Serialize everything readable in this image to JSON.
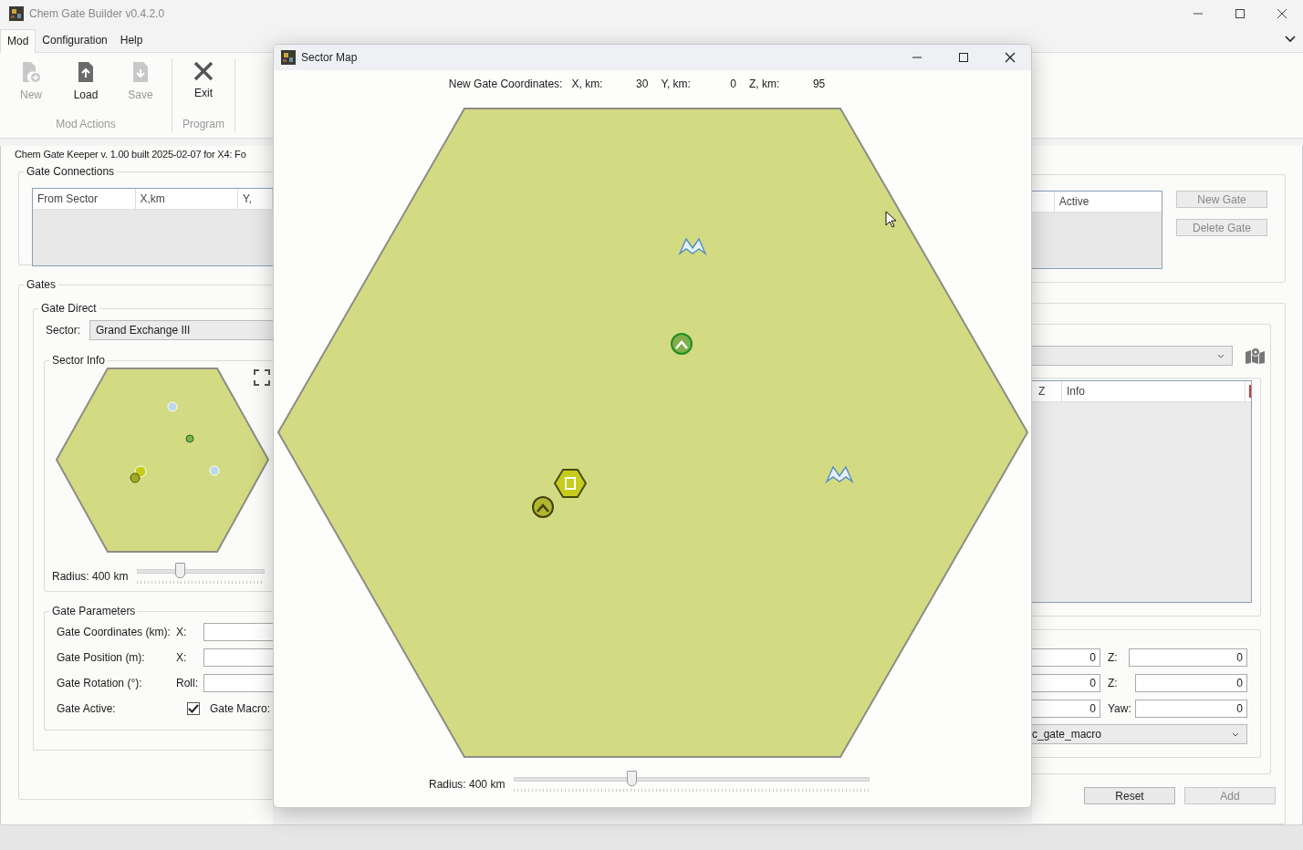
{
  "window": {
    "title": "Chem Gate Builder v0.4.2.0"
  },
  "menu": [
    {
      "label": "Mod",
      "selected": true
    },
    {
      "label": "Configuration",
      "selected": false
    },
    {
      "label": "Help",
      "selected": false
    }
  ],
  "ribbon": [
    {
      "label": "Mod Actions",
      "buttons": [
        {
          "label": "New",
          "kind": "new",
          "disabled": true
        },
        {
          "label": "Load",
          "kind": "load",
          "disabled": false
        },
        {
          "label": "Save",
          "kind": "save",
          "disabled": true
        }
      ]
    },
    {
      "label": "Program",
      "buttons": [
        {
          "label": "Exit",
          "kind": "exit",
          "disabled": false
        }
      ]
    }
  ],
  "info_text": "Chem Gate Keeper v. 1.00 built 2025-02-07 for X4: Fo",
  "gate_connections": {
    "title": "Gate Connections",
    "columns_left": [
      "From Sector",
      "X,km",
      "Y,"
    ],
    "columns_right": [
      "Active"
    ],
    "buttons": [
      {
        "label": "New Gate",
        "disabled": true
      },
      {
        "label": "Delete Gate",
        "disabled": true
      }
    ]
  },
  "gates": {
    "title": "Gates",
    "gate_direct": {
      "title": "Gate Direct",
      "sector_label": "Sector:",
      "sector_value": "Grand Exchange III"
    },
    "sector_info": {
      "title": "Sector Info",
      "radius_label": "Radius: 400 km",
      "level": 0.33,
      "columns": [
        "Z",
        "Info"
      ]
    },
    "parameters": {
      "title": "Gate Parameters",
      "rows": [
        {
          "kind": "fields",
          "label": "Gate Coordinates (km):",
          "first_label": "X:",
          "second_value": "0",
          "third_label": "Z:",
          "third_value": "0"
        },
        {
          "kind": "fields",
          "label": "Gate Position (m):",
          "first_label": "X:",
          "second_value": "0",
          "third_label": "Z:",
          "third_value": "0"
        },
        {
          "kind": "fields",
          "label": "Gate Rotation (°):",
          "first_label": "Roll:",
          "second_value": "0",
          "third_label": "Yaw:",
          "third_value": "0"
        },
        {
          "kind": "options",
          "label": "Gate Active:",
          "checked": true,
          "macro_label": "Gate Macro:",
          "macro_value": "c_gate_macro"
        }
      ]
    }
  },
  "buttons": [
    {
      "label": "Reset",
      "disabled": false
    },
    {
      "label": "Add",
      "disabled": true
    }
  ],
  "sector_map": {
    "title": "Sector Map",
    "coords_label": "New Gate Coordinates:",
    "coords": [
      {
        "label": "X, km:",
        "value": "30"
      },
      {
        "label": "Y, km:",
        "value": "0"
      },
      {
        "label": "Z, km:",
        "value": "95"
      }
    ],
    "radius_label": "Radius: 400 km",
    "level": 0.33
  }
}
